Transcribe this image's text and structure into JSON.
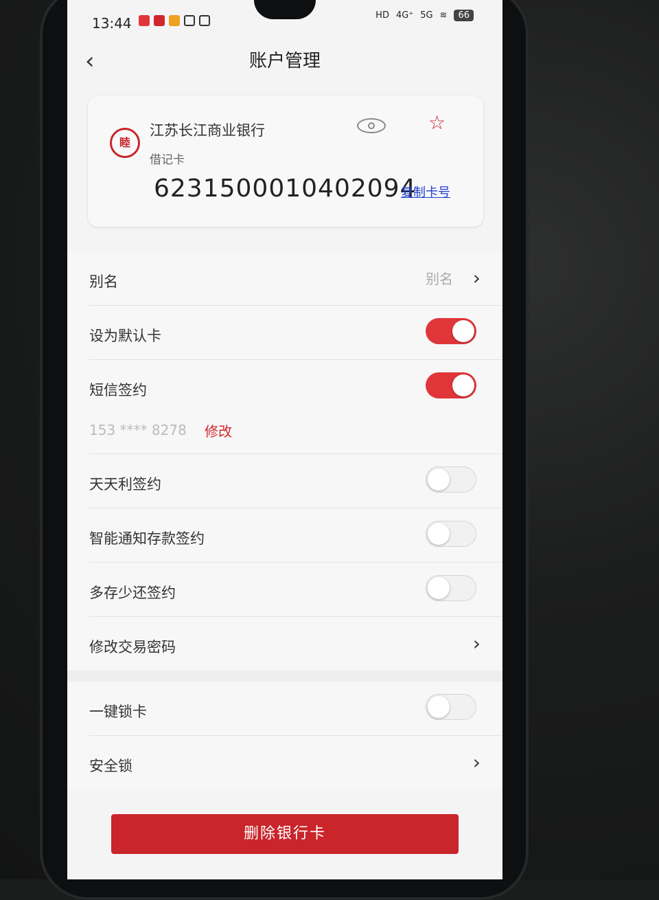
{
  "status_bar": {
    "time": "13:44",
    "net_1": "4G⁺",
    "net_2": "5G",
    "battery": "66"
  },
  "navbar": {
    "title": "账户管理"
  },
  "card": {
    "bank_name": "江苏长江商业银行",
    "card_type": "借记卡",
    "card_number": "6231500010402094",
    "copy_label": "复制卡号",
    "logo_text": "睦"
  },
  "settings": {
    "alias_label": "别名",
    "alias_value": "别名",
    "default_card_label": "设为默认卡",
    "sms_label": "短信签约",
    "sms_phone": "153 **** 8278",
    "sms_modify": "修改",
    "tiantianli_label": "天天利签约",
    "smart_notice_label": "智能通知存款签约",
    "duocun_label": "多存少还签约",
    "change_pwd_label": "修改交易密码"
  },
  "security": {
    "lock_card_label": "一键锁卡",
    "security_lock_label": "安全锁"
  },
  "delete_button": "删除银行卡",
  "toggles": {
    "default_card": true,
    "sms": true,
    "tiantianli": false,
    "smart_notice": false,
    "duocun": false,
    "lock_card": false
  },
  "colors": {
    "accent": "#e0363a",
    "link": "#1f3fd0"
  }
}
